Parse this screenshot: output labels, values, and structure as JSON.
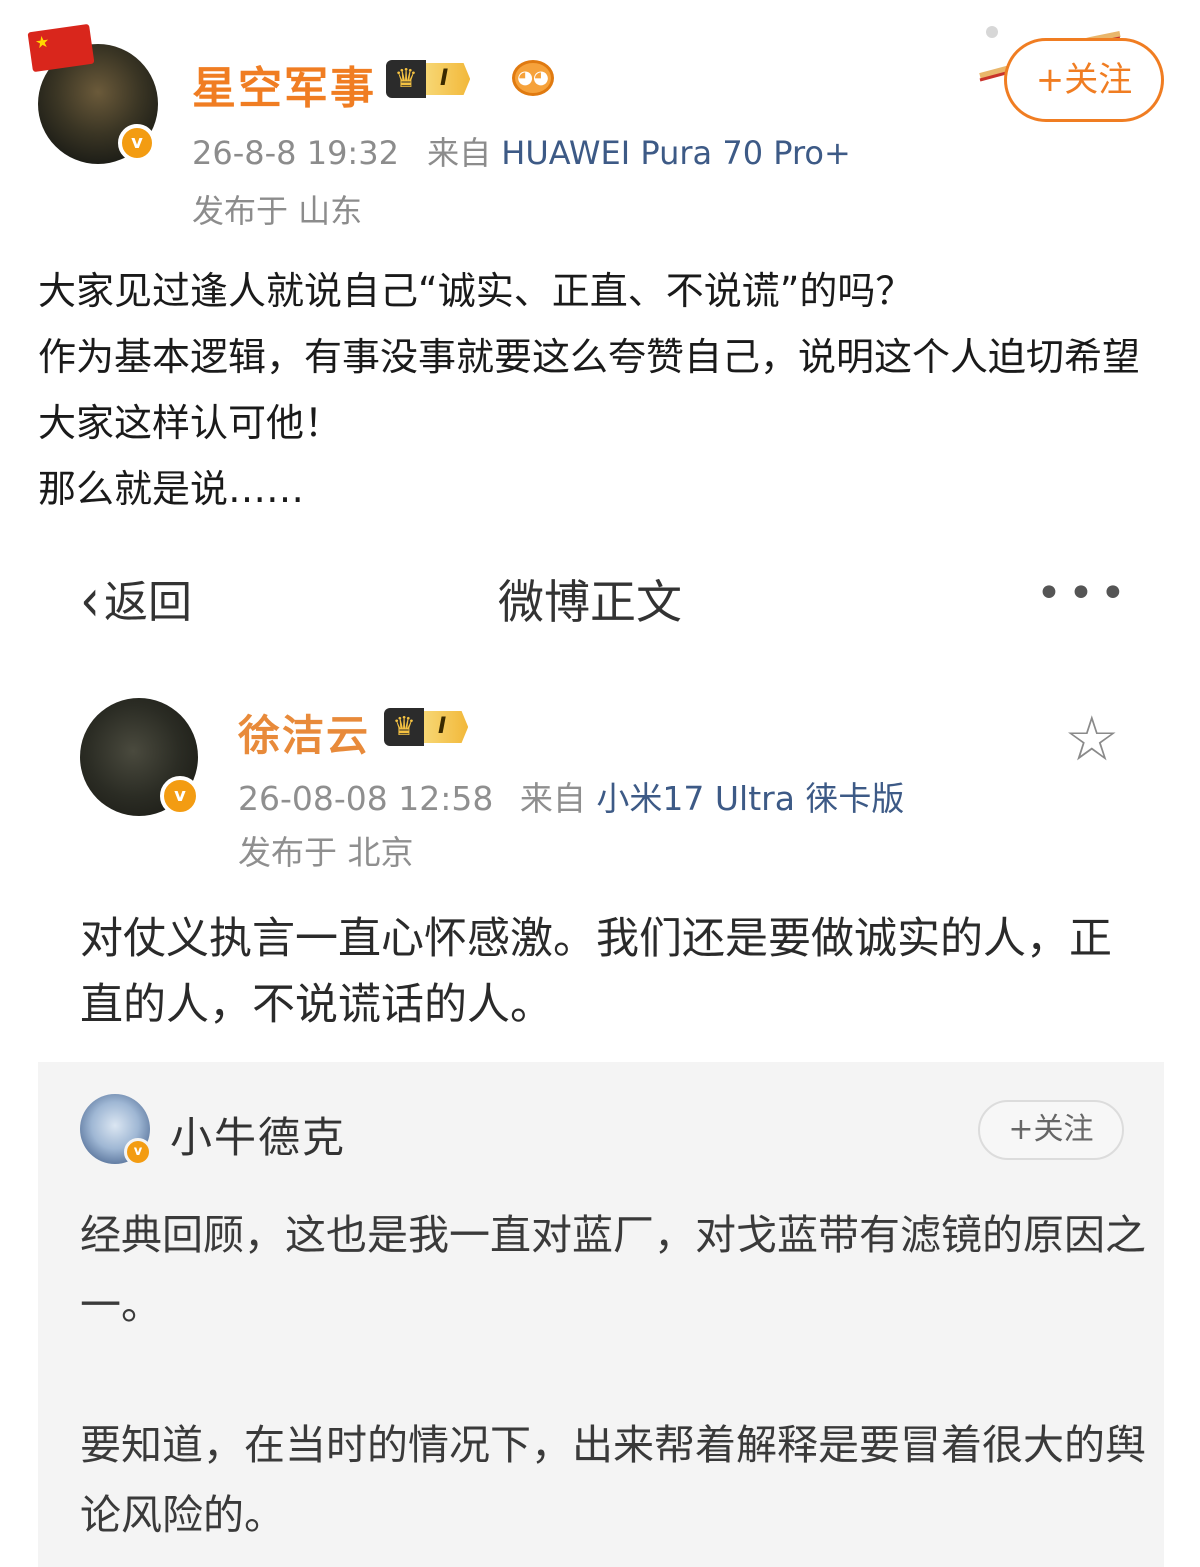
{
  "main_post": {
    "author": "星空军事",
    "level_badge": "I",
    "timestamp": "26-8-8 19:32",
    "source_prefix": "来自",
    "device": "HUAWEI Pura 70 Pro+",
    "location": "发布于 山东",
    "follow_label": "+关注",
    "verified_mark": "v",
    "body": [
      "大家见过逢人就说自己“诚实、正直、不说谎”的吗？",
      "作为基本逻辑，有事没事就要这么夸赞自己，说明这个人迫切希望大家这样认可他！",
      "那么就是说……"
    ]
  },
  "embedded_screenshot": {
    "nav": {
      "back_label": "返回",
      "title": "微博正文",
      "more_label": "•••"
    },
    "post": {
      "author": "徐洁云",
      "level_badge": "I",
      "timestamp": "26-08-08 12:58",
      "source_prefix": "来自",
      "device": "小米17 Ultra 徕卡版",
      "location": "发布于 北京",
      "verified_mark": "v",
      "body": "对仗义执言一直心怀感激。我们还是要做诚实的人，正直的人，不说谎话的人。"
    },
    "quoted": {
      "author": "小牛德克",
      "follow_label": "+关注",
      "verified_mark": "v",
      "paragraphs": [
        "经典回顾，这也是我一直对蓝厂，对戈蓝带有滤镜的原因之一。",
        "要知道，在当时的情况下，出来帮着解释是要冒着很大的舆论风险的。"
      ]
    }
  },
  "colors": {
    "brand_orange": "#f07d22",
    "device_link": "#3d5a86",
    "meta_gray": "#8c8c8c",
    "quote_bg": "#f4f4f4"
  },
  "icons": {
    "flag": "china-flag-icon",
    "crown": "crown-icon",
    "fish": "fish-emoji-icon",
    "star": "star-outline-icon",
    "back": "chevron-left-icon",
    "more": "more-dots-icon"
  }
}
